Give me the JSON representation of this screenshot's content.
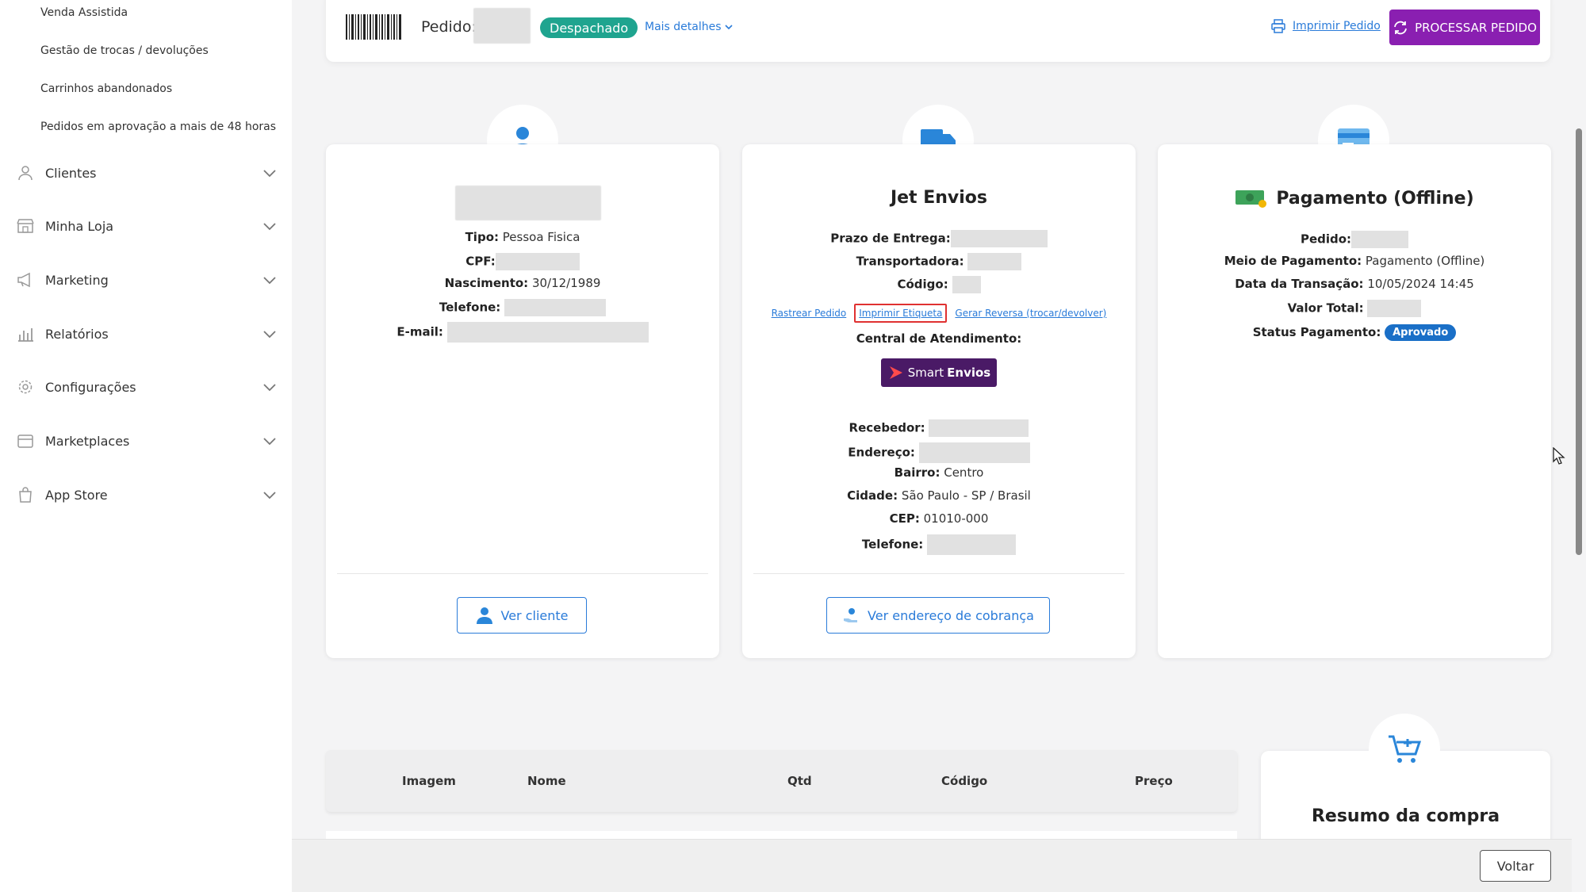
{
  "sidebar": {
    "sub_items": [
      "Venda Assistida",
      "Gestão de trocas / devoluções",
      "Carrinhos abandonados",
      "Pedidos em aprovação a mais de 48 horas"
    ],
    "menu": [
      {
        "label": "Clientes",
        "icon": "user-icon"
      },
      {
        "label": "Minha Loja",
        "icon": "store-icon"
      },
      {
        "label": "Marketing",
        "icon": "megaphone-icon"
      },
      {
        "label": "Relatórios",
        "icon": "chart-icon"
      },
      {
        "label": "Configurações",
        "icon": "gear-icon"
      },
      {
        "label": "Marketplaces",
        "icon": "marketplace-icon"
      },
      {
        "label": "App Store",
        "icon": "bag-icon"
      }
    ]
  },
  "header": {
    "pedido_label": "Pedido:",
    "status": "Despachado",
    "mais_detalhes": "Mais detalhes",
    "imprimir_pedido": "Imprimir Pedido",
    "processar_pedido": "PROCESSAR PEDIDO"
  },
  "cliente": {
    "tipo_label": "Tipo:",
    "tipo_value": "Pessoa Fisica",
    "cpf_label": "CPF:",
    "nascimento_label": "Nascimento:",
    "nascimento_value": "30/12/1989",
    "telefone_label": "Telefone:",
    "email_label": "E-mail:",
    "button": "Ver cliente"
  },
  "envio": {
    "title": "Jet Envios",
    "prazo_label": "Prazo de Entrega:",
    "transportadora_label": "Transportadora:",
    "codigo_label": "Código:",
    "rastrear": "Rastrear Pedido",
    "imprimir_etiqueta": "Imprimir Etiqueta",
    "gerar_reversa": "Gerar Reversa (trocar/devolver)",
    "central_label": "Central de Atendimento:",
    "logo_text_a": "Smart",
    "logo_text_b": "Envios",
    "recebedor_label": "Recebedor:",
    "endereco_label": "Endereço:",
    "bairro_label": "Bairro:",
    "bairro_value": "Centro",
    "cidade_label": "Cidade:",
    "cidade_value": "São Paulo - SP / Brasil",
    "cep_label": "CEP:",
    "cep_value": "01010-000",
    "telefone_label": "Telefone:",
    "button": "Ver endereço de cobrança"
  },
  "pagamento": {
    "title": "Pagamento (Offline)",
    "pedido_label": "Pedido:",
    "meio_label": "Meio de Pagamento:",
    "meio_value": "Pagamento (Offline)",
    "data_label": "Data da Transação:",
    "data_value": "10/05/2024 14:45",
    "valor_label": "Valor Total:",
    "status_label": "Status Pagamento:",
    "status_value": "Aprovado"
  },
  "table": {
    "headers": [
      "Imagem",
      "Nome",
      "Qtd",
      "Código",
      "Preço"
    ]
  },
  "resumo": {
    "title": "Resumo da compra"
  },
  "footer": {
    "voltar": "Voltar"
  },
  "colors": {
    "accent": "#2a7bd9",
    "status_green": "#1fa48f",
    "process_purple": "#8a1fb1",
    "badge_blue": "#1a6fc7",
    "highlight_red": "#e03131"
  }
}
